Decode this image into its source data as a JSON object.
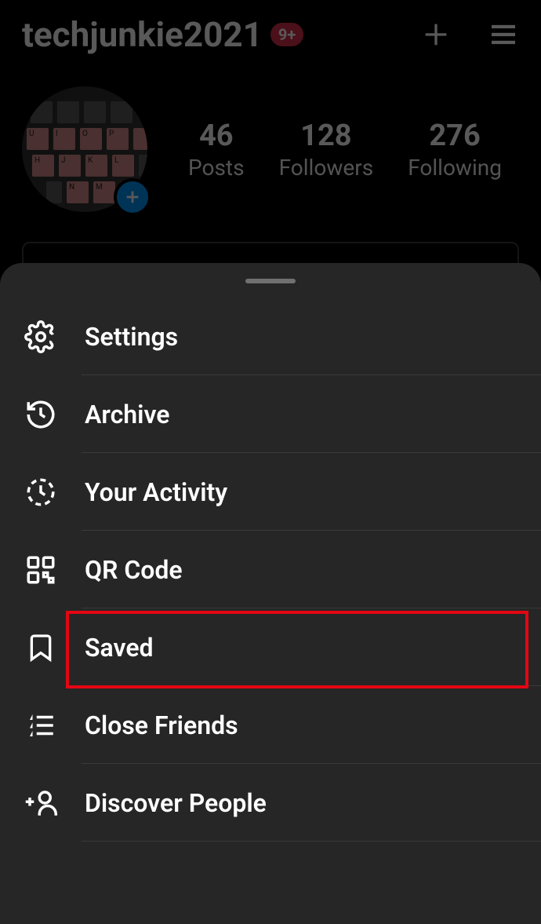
{
  "header": {
    "username": "techjunkie2021",
    "badge": "9+"
  },
  "stats": {
    "posts": {
      "count": "46",
      "label": "Posts"
    },
    "followers": {
      "count": "128",
      "label": "Followers"
    },
    "following": {
      "count": "276",
      "label": "Following"
    }
  },
  "menu": {
    "settings": "Settings",
    "archive": "Archive",
    "activity": "Your Activity",
    "qrcode": "QR Code",
    "saved": "Saved",
    "close_friends": "Close Friends",
    "discover": "Discover People"
  }
}
